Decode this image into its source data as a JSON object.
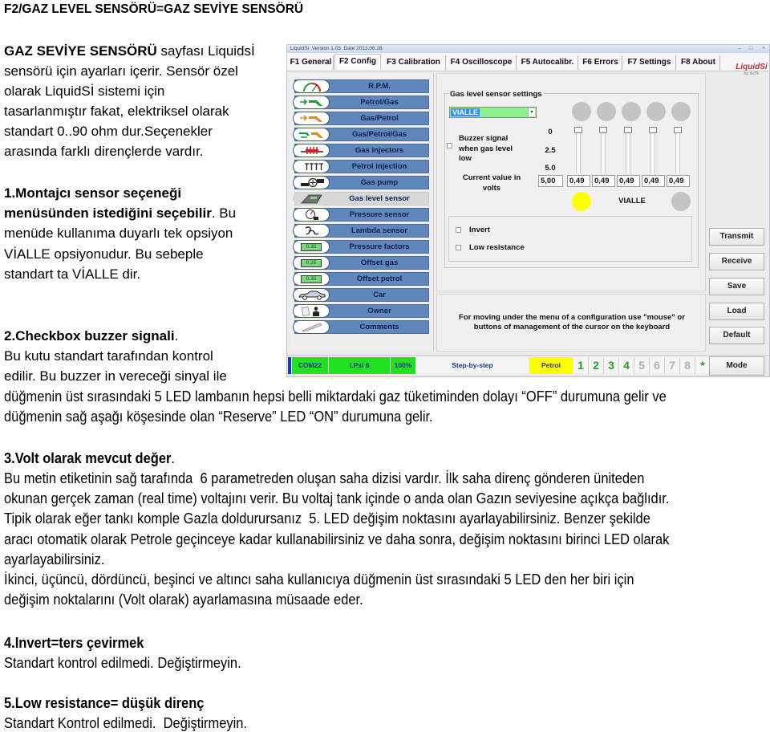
{
  "doc": {
    "heading": "F2/GAZ LEVEL SENSÖRÜ=GAZ SEVİYE SENSÖRÜ",
    "intro": {
      "lead_bold": "GAZ SEVİYE SENSÖRÜ",
      "lead_rest": " sayfası Liquidsİ",
      "lines": [
        "sensörü için ayarları içerir. Sensör özel",
        "olarak LiquidSİ sistemi için",
        "tasarlanmıştır fakat, elektriksel olarak",
        "standart 0..90 ohm dur.Seçenekler",
        "arasında farklı dirençlerde vardır."
      ]
    },
    "s1": {
      "title_1": "1.Montajcı sensor seçeneği",
      "title_2": "menüsünden istediğini seçebilir",
      "title_2_rest": ". Bu",
      "lines": [
        "menüde kullanıma duyarlı tek opsiyon",
        "VİALLE opsiyonudur. Bu sebeple",
        "standart ta VİALLE dir."
      ]
    },
    "s2": {
      "title": "2.Checkbox buzzer signali",
      "title_rest": ".",
      "lines": [
        "Bu kutu standart tarafından kontrol",
        "edilir. Bu buzzer in vereceği sinyal ile"
      ],
      "lines_full": [
        "düğmenin üst sırasındaki 5 LED lambanın hepsi belli miktardaki gaz tüketiminden dolayı “OFF” durumuna gelir ve",
        "düğmenin sağ aşağı köşesinde olan “Reserve” LED “ON” durumuna gelir."
      ]
    },
    "s3": {
      "title": "3.Volt olarak mevcut değer",
      "title_rest": ".",
      "lines": [
        "Bu metin etiketinin sağ tarafında  6 parametreden oluşan saha dizisi vardır. İlk saha direnç gönderen üniteden",
        "okunan gerçek zaman (real time) voltajını verir. Bu voltaj tank içinde o anda olan Gazın seviyesine açıkça bağlıdır.",
        "Tipik olarak eğer tankı komple Gazla doldurursanız  5. LED değişim noktasını ayarlayabilirsiniz. Benzer şekilde",
        "aracı otomatik olarak Petrole geçinceye kadar kullanabilirsiniz ve daha sonra, değişim noktasını birinci LED olarak",
        "ayarlayabilirsiniz.",
        "İkinci, üçüncü, dördüncü, beşinci ve altıncı saha kullanıcıya düğmenin üst sırasındaki 5 LED den her biri için",
        "değişim noktalarını (Volt olarak) ayarlamasına müsaade eder."
      ]
    },
    "s4": {
      "title": "4.Invert=ters çevirmek",
      "lines": [
        "Standart kontrol edilmedi. Değiştirmeyin."
      ]
    },
    "s5": {
      "title": "5.Low resistance= düşük direnç",
      "lines": [
        "Standart Kontrol edilmedi.  Değiştirmeyin."
      ]
    }
  },
  "app": {
    "window_title": "LiquidSi  Version 1.03  Date 2013.06.28",
    "window_controls": {
      "minimize": "–",
      "maximize": "□",
      "close": "×"
    },
    "logo": "LiquidSi",
    "logo_sub": "by AcTe",
    "tabs": [
      {
        "label": "F1 General"
      },
      {
        "label": "F2 Config",
        "active": true
      },
      {
        "label": "F3 Calibration"
      },
      {
        "label": "F4 Oscilloscope"
      },
      {
        "label": "F5 Autocalibr."
      },
      {
        "label": "F6 Errors"
      },
      {
        "label": "F7 Settings"
      },
      {
        "label": "F8 About"
      }
    ],
    "menu": [
      {
        "label": "R.P.M.",
        "icon": "rpm-gauge-icon"
      },
      {
        "label": "Petrol/Gas",
        "icon": "petrol-gas-icon"
      },
      {
        "label": "Gas/Petrol",
        "icon": "gas-petrol-icon"
      },
      {
        "label": "Gas/Petrol/Gas",
        "icon": "gas-petrol-gas-icon"
      },
      {
        "label": "Gas injectors",
        "icon": "gas-injectors-icon"
      },
      {
        "label": "Petrol injection",
        "icon": "petrol-injection-icon"
      },
      {
        "label": "Gas pump",
        "icon": "gas-pump-icon"
      },
      {
        "label": "Gas level sensor",
        "icon": "gas-level-sensor-icon",
        "selected": true
      },
      {
        "label": "Pressure sensor",
        "icon": "pressure-sensor-icon"
      },
      {
        "label": "Lambda sensor",
        "icon": "lambda-sensor-icon"
      },
      {
        "label": "Pressure factors",
        "icon": "pressure-factors-icon",
        "icon_value": "0,35"
      },
      {
        "label": "Offset gas",
        "icon": "offset-gas-icon",
        "icon_value": "0,25"
      },
      {
        "label": "Offset petrol",
        "icon": "offset-petrol-icon",
        "icon_value": "0,35"
      },
      {
        "label": "Car",
        "icon": "car-icon"
      },
      {
        "label": "Owner",
        "icon": "owner-icon"
      },
      {
        "label": "Comments",
        "icon": "comments-icon"
      }
    ],
    "settings": {
      "group_title": "Gas level sensor settings",
      "sensor_select": "VIALLE",
      "dropdown_arrow": "▾",
      "buzzer_label_lines": [
        "Buzzer signal",
        "when gas level",
        "low"
      ],
      "buzzer_checked": false,
      "scale": [
        "0",
        "2.5",
        "5.0"
      ],
      "scale_range_volts": [
        0,
        5
      ],
      "current_value_label_lines": [
        "Current value in",
        "volts"
      ],
      "values": [
        "5,00",
        "0,49",
        "0,49",
        "0,49",
        "0,49",
        "0,49"
      ],
      "level_leds": [
        "off",
        "off",
        "off",
        "off",
        "off"
      ],
      "slider_values_volts": [
        0,
        0,
        0,
        0,
        0
      ],
      "sensor_led": "on",
      "sensor_name": "VIALLE",
      "reserve_led": "off",
      "invert_label": "Invert",
      "invert_checked": false,
      "low_resistance_label": "Low resistance",
      "low_resistance_checked": false
    },
    "hint_lines": [
      "For moving under the menu of a configuration use \"mouse\" or",
      "buttons of management of the cursor on the keyboard"
    ],
    "buttons": {
      "transmit": "Transmit",
      "receive": "Receive",
      "save": "Save",
      "load": "Load",
      "default": "Default",
      "mode": "Mode"
    },
    "status": {
      "port": "COM22",
      "device": "LPsi 6",
      "percent": "100%",
      "mode": "Step-by-step",
      "fuel": "Petrol",
      "cylinders": [
        {
          "n": "1",
          "active": true
        },
        {
          "n": "2",
          "active": true
        },
        {
          "n": "3",
          "active": true
        },
        {
          "n": "4",
          "active": true
        },
        {
          "n": "5",
          "active": false
        },
        {
          "n": "6",
          "active": false
        },
        {
          "n": "7",
          "active": false
        },
        {
          "n": "8",
          "active": false
        }
      ],
      "all": "*"
    },
    "colors": {
      "menu_bar": "#5f87bb",
      "menu_selected": "#d7d7d7",
      "status_green": "#22e022",
      "status_yellow": "#ffff00",
      "led_on": "#ffff00",
      "led_off": "#c4c4c4",
      "cyl_active": "#2a9a2a",
      "cyl_inactive": "#b0b0b0",
      "dropdown_bg": "#8ff08f"
    }
  }
}
